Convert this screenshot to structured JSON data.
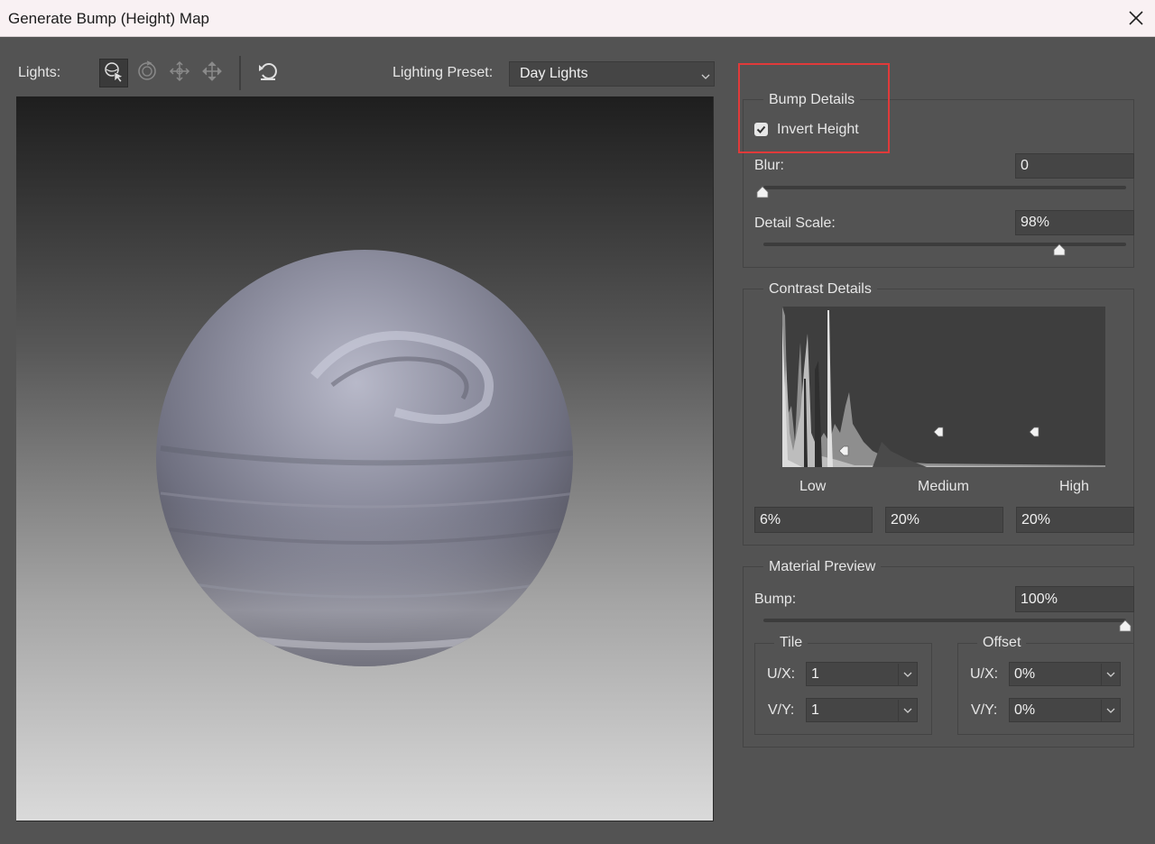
{
  "window": {
    "title": "Generate Bump (Height) Map"
  },
  "toolbar": {
    "lights_label": "Lights:",
    "preset_label": "Lighting Preset:",
    "preset_value": "Day Lights",
    "tools": [
      "select-light-icon",
      "rotate-icon",
      "move-icon",
      "pan-icon",
      "reset-icon"
    ]
  },
  "bump_details": {
    "legend": "Bump Details",
    "invert_height_label": "Invert Height",
    "invert_height_checked": true,
    "blur_label": "Blur:",
    "blur_value": "0",
    "blur_fraction": 0.0,
    "detail_scale_label": "Detail Scale:",
    "detail_scale_value": "98%",
    "detail_scale_fraction": 0.82
  },
  "contrast_details": {
    "legend": "Contrast Details",
    "low_label": "Low",
    "medium_label": "Medium",
    "high_label": "High",
    "low_value": "6%",
    "medium_value": "20%",
    "high_value": "20%"
  },
  "material_preview": {
    "legend": "Material Preview",
    "bump_label": "Bump:",
    "bump_value": "100%",
    "bump_fraction": 1.0,
    "tile": {
      "legend": "Tile",
      "ux_label": "U/X:",
      "ux_value": "1",
      "vy_label": "V/Y:",
      "vy_value": "1"
    },
    "offset": {
      "legend": "Offset",
      "ux_label": "U/X:",
      "ux_value": "0%",
      "vy_label": "V/Y:",
      "vy_value": "0%"
    }
  },
  "colors": {
    "panel": "#535353",
    "field": "#454545",
    "highlight": "#e03a3a",
    "titlebar": "#f9f1f3"
  }
}
